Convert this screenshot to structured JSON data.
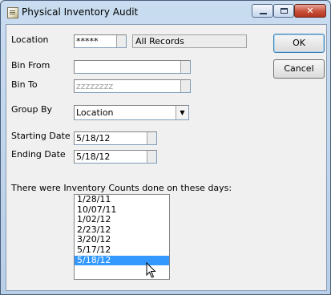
{
  "window": {
    "title": "Physical Inventory Audit",
    "caption_buttons": {
      "minimize": "",
      "maximize": "",
      "close": "✕"
    }
  },
  "form": {
    "location": {
      "label": "Location",
      "value": "*****",
      "description": "All Records"
    },
    "bin_from": {
      "label": "Bin From",
      "value": ""
    },
    "bin_to": {
      "label": "Bin To",
      "value": "zzzzzzzz"
    },
    "group_by": {
      "label": "Group By",
      "selected": "Location"
    },
    "starting_date": {
      "label": "Starting Date",
      "value": "5/18/12"
    },
    "ending_date": {
      "label": "Ending Date",
      "value": "5/18/12"
    }
  },
  "buttons": {
    "ok": "OK",
    "cancel": "Cancel"
  },
  "counts": {
    "label": "There were Inventory Counts done on these days:",
    "dates": [
      "1/28/11",
      "10/07/11",
      "1/02/12",
      "2/23/12",
      "3/20/12",
      "5/17/12",
      "5/18/12"
    ],
    "selected_index": 6
  },
  "icons": {
    "title_icon": "document-icon",
    "pointer": "mouse-pointer-icon"
  },
  "colors": {
    "selection": "#3399ff",
    "close_button": "#c7503a"
  }
}
